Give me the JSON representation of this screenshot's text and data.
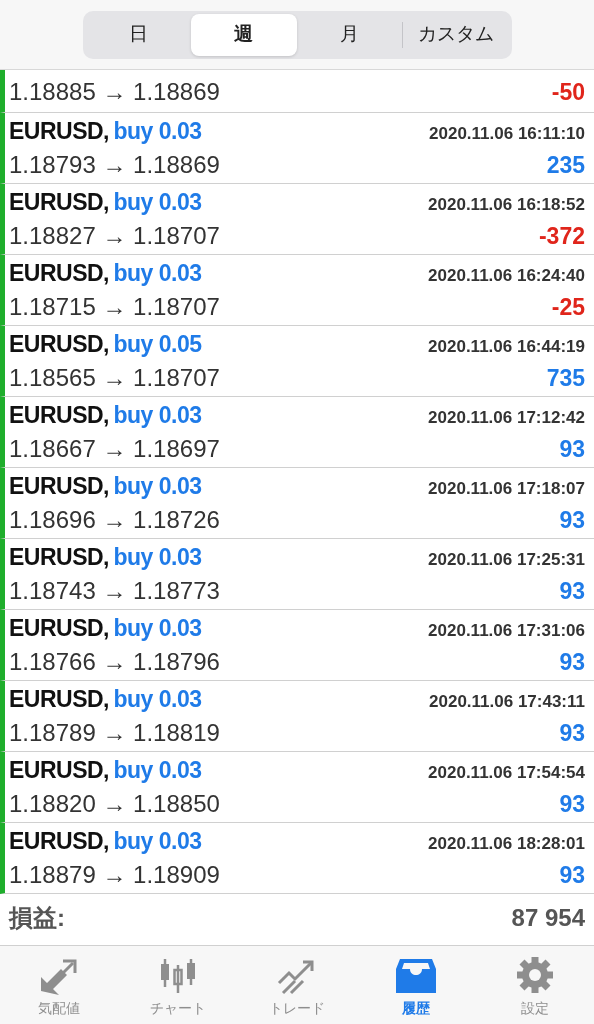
{
  "segments": [
    {
      "label": "日",
      "selected": false
    },
    {
      "label": "週",
      "selected": true
    },
    {
      "label": "月",
      "selected": false
    },
    {
      "label": "カスタム",
      "selected": false
    }
  ],
  "deals": [
    {
      "kind": "partial",
      "prices": "1.18885 → 1.18869",
      "profit": "-50",
      "loss": true
    },
    {
      "kind": "full",
      "symbol": "EURUSD,",
      "order": "buy 0.03",
      "time": "2020.11.06 16:11:10",
      "prices": "1.18793 → 1.18869",
      "profit": "235",
      "loss": false
    },
    {
      "kind": "full",
      "symbol": "EURUSD,",
      "order": "buy 0.03",
      "time": "2020.11.06 16:18:52",
      "prices": "1.18827 → 1.18707",
      "profit": "-372",
      "loss": true
    },
    {
      "kind": "full",
      "symbol": "EURUSD,",
      "order": "buy 0.03",
      "time": "2020.11.06 16:24:40",
      "prices": "1.18715 → 1.18707",
      "profit": "-25",
      "loss": true
    },
    {
      "kind": "full",
      "symbol": "EURUSD,",
      "order": "buy 0.05",
      "time": "2020.11.06 16:44:19",
      "prices": "1.18565 → 1.18707",
      "profit": "735",
      "loss": false
    },
    {
      "kind": "full",
      "symbol": "EURUSD,",
      "order": "buy 0.03",
      "time": "2020.11.06 17:12:42",
      "prices": "1.18667 → 1.18697",
      "profit": "93",
      "loss": false
    },
    {
      "kind": "full",
      "symbol": "EURUSD,",
      "order": "buy 0.03",
      "time": "2020.11.06 17:18:07",
      "prices": "1.18696 → 1.18726",
      "profit": "93",
      "loss": false
    },
    {
      "kind": "full",
      "symbol": "EURUSD,",
      "order": "buy 0.03",
      "time": "2020.11.06 17:25:31",
      "prices": "1.18743 → 1.18773",
      "profit": "93",
      "loss": false
    },
    {
      "kind": "full",
      "symbol": "EURUSD,",
      "order": "buy 0.03",
      "time": "2020.11.06 17:31:06",
      "prices": "1.18766 → 1.18796",
      "profit": "93",
      "loss": false
    },
    {
      "kind": "full",
      "symbol": "EURUSD,",
      "order": "buy 0.03",
      "time": "2020.11.06 17:43:11",
      "prices": "1.18789 → 1.18819",
      "profit": "93",
      "loss": false
    },
    {
      "kind": "full",
      "symbol": "EURUSD,",
      "order": "buy 0.03",
      "time": "2020.11.06 17:54:54",
      "prices": "1.18820 → 1.18850",
      "profit": "93",
      "loss": false
    },
    {
      "kind": "full",
      "symbol": "EURUSD,",
      "order": "buy 0.03",
      "time": "2020.11.06 18:28:01",
      "prices": "1.18879 → 1.18909",
      "profit": "93",
      "loss": false
    }
  ],
  "summary": {
    "label": "損益:",
    "value": "87 954"
  },
  "tab_bar": [
    {
      "kind": "quotes",
      "label": "気配値",
      "selected": false
    },
    {
      "kind": "chart",
      "label": "チャート",
      "selected": false
    },
    {
      "kind": "trade",
      "label": "トレード",
      "selected": false
    },
    {
      "kind": "history",
      "label": "履歴",
      "selected": true
    },
    {
      "kind": "settings",
      "label": "設定",
      "selected": false
    }
  ]
}
